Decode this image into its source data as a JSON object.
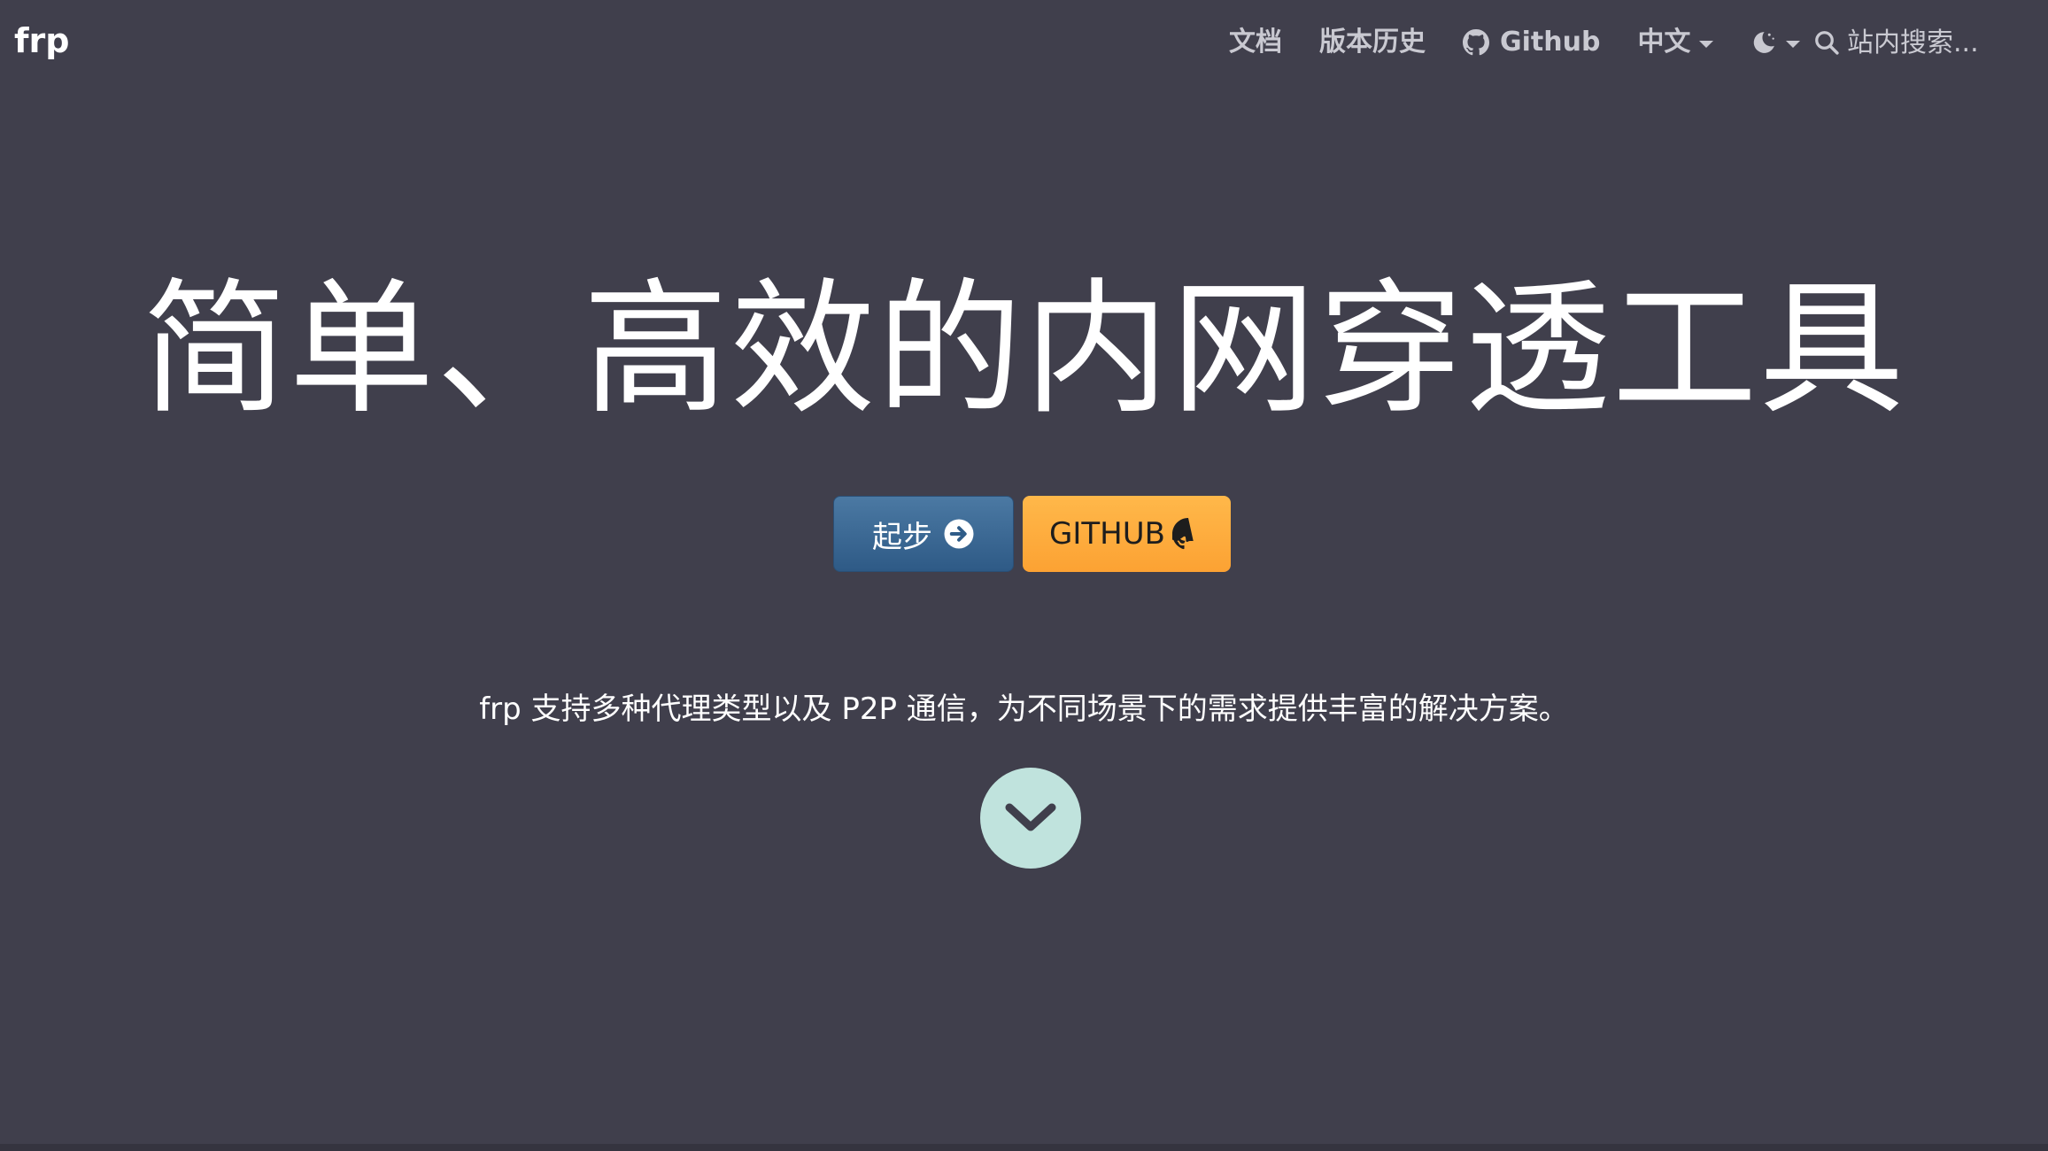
{
  "navbar": {
    "brand": "frp",
    "links": {
      "docs": "文档",
      "releases": "版本历史",
      "github": "Github",
      "language": "中文"
    },
    "theme_icon": "moon-icon",
    "search": {
      "placeholder": "站内搜索..."
    }
  },
  "hero": {
    "title": "简单、高效的内网穿透工具",
    "buttons": {
      "start": "起步",
      "github": "GITHUB"
    },
    "subtitle": "frp 支持多种代理类型以及 P2P 通信，为不同场景下的需求提供丰富的解决方案。",
    "scroll_icon": "chevron-down-icon"
  },
  "colors": {
    "background": "#403f4c",
    "primary_button": "#3b6a96",
    "secondary_button": "#fdaf40",
    "scroll_circle": "#c0e3dd"
  }
}
